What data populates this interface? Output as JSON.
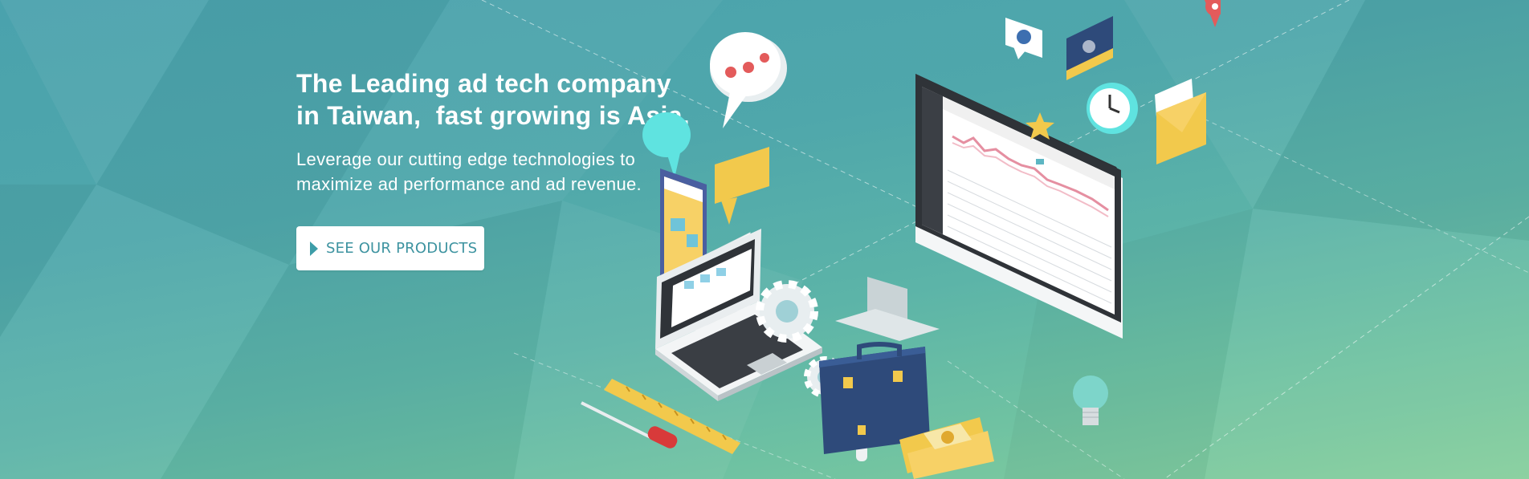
{
  "hero": {
    "headline": [
      "The Leading ad tech company",
      "in Taiwan,  fast growing is Asia."
    ],
    "subheadline": [
      "Leverage our cutting edge technologies to",
      "maximize ad performance and ad revenue."
    ],
    "cta_label": "SEE OUR PRODUCTS"
  },
  "illustration": {
    "icons": [
      "chat-bubble-icon",
      "monitor-dashboard-icon",
      "laptop-icon",
      "mobile-site-icon",
      "report-document-icon",
      "gear-icon",
      "small-gear-icon",
      "wrench-icon",
      "lightbulb-icon",
      "briefcase-icon",
      "books-icon",
      "ruler-icon",
      "screwdriver-icon",
      "clock-icon",
      "mail-icon",
      "star-icon",
      "video-bubble-icon",
      "video-player-icon",
      "map-pin-icon"
    ]
  },
  "colors": {
    "background_top": "#4aa2ad",
    "background_bottom": "#86cf9c",
    "button_background": "#ffffff",
    "button_text": "#3d93a0",
    "headline_text": "#ffffff"
  }
}
